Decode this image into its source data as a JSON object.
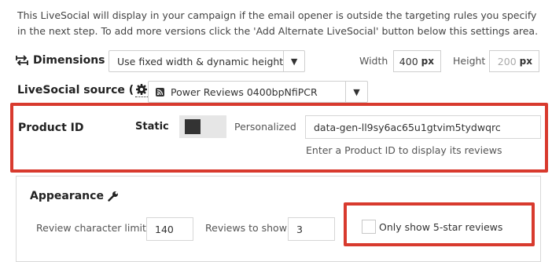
{
  "intro_text": "This LiveSocial will display in your campaign if the email opener is outside the targeting rules you specify in the next step. To add more versions click the 'Add Alternate LiveSocial' button below this settings area.",
  "dimensions": {
    "label": "Dimensions",
    "mode_select": "Use fixed width & dynamic height",
    "width_label": "Width",
    "width_value": "400",
    "width_unit": "px",
    "height_label": "Height",
    "height_placeholder": "200",
    "height_unit": "px"
  },
  "source": {
    "label_prefix": "LiveSocial source (",
    "label_suffix": ")",
    "select_value": "Power Reviews 0400bpNfiPCR"
  },
  "product": {
    "label": "Product ID",
    "static_label": "Static",
    "personalized_label": "Personalized",
    "input_value": "data-gen-ll9sy6ac65u1gtvim5tydwqrc",
    "help_text": "Enter a Product ID to display its reviews"
  },
  "appearance": {
    "title": "Appearance",
    "char_limit_label": "Review character limit",
    "char_limit_value": "140",
    "reviews_label": "Reviews to show",
    "reviews_value": "3",
    "five_star_label": "Only show 5-star reviews"
  },
  "colors": {
    "highlight": "#d83a2e",
    "toggle_knob": "#333333",
    "toggle_track": "#e6e6e6"
  },
  "icons": [
    "dimensions-icon",
    "gear-icon",
    "rss-icon",
    "chevron-down-icon",
    "wrench-icon"
  ]
}
